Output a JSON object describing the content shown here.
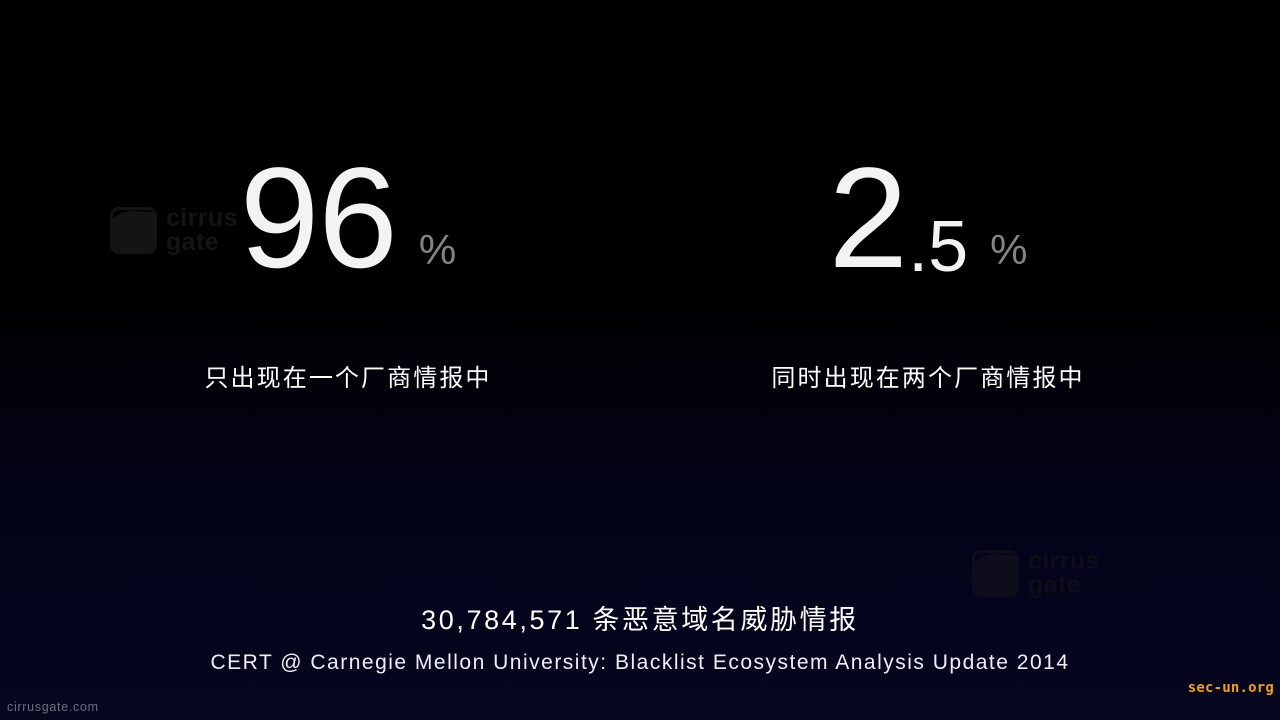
{
  "slide": {
    "background_top_color": "#000000",
    "background_bottom_color": "#06061f"
  },
  "stats": [
    {
      "value": "96",
      "fraction": "",
      "unit": "%",
      "caption": "只出现在一个厂商情报中",
      "value_color": "#f3f3f3",
      "unit_color": "#848484"
    },
    {
      "value": "2",
      "fraction": ".5",
      "unit": "%",
      "caption": "同时出现在两个厂商情报中",
      "value_color": "#f3f3f3",
      "unit_color": "#848484"
    }
  ],
  "footer": {
    "headline": "30,784,571 条恶意域名威胁情报",
    "source": "CERT @ Carnegie Mellon University: Blacklist Ecosystem Analysis Update 2014"
  },
  "watermarks": [
    {
      "line1": "cirrus",
      "line2": "gate",
      "color": "#141414"
    },
    {
      "line1": "cirrus",
      "line2": "gate",
      "color": "#0d0d1c"
    }
  ],
  "corners": {
    "site": "cirrusgate.com",
    "credit": "sec-un.org",
    "credit_color": "#f0a010"
  }
}
